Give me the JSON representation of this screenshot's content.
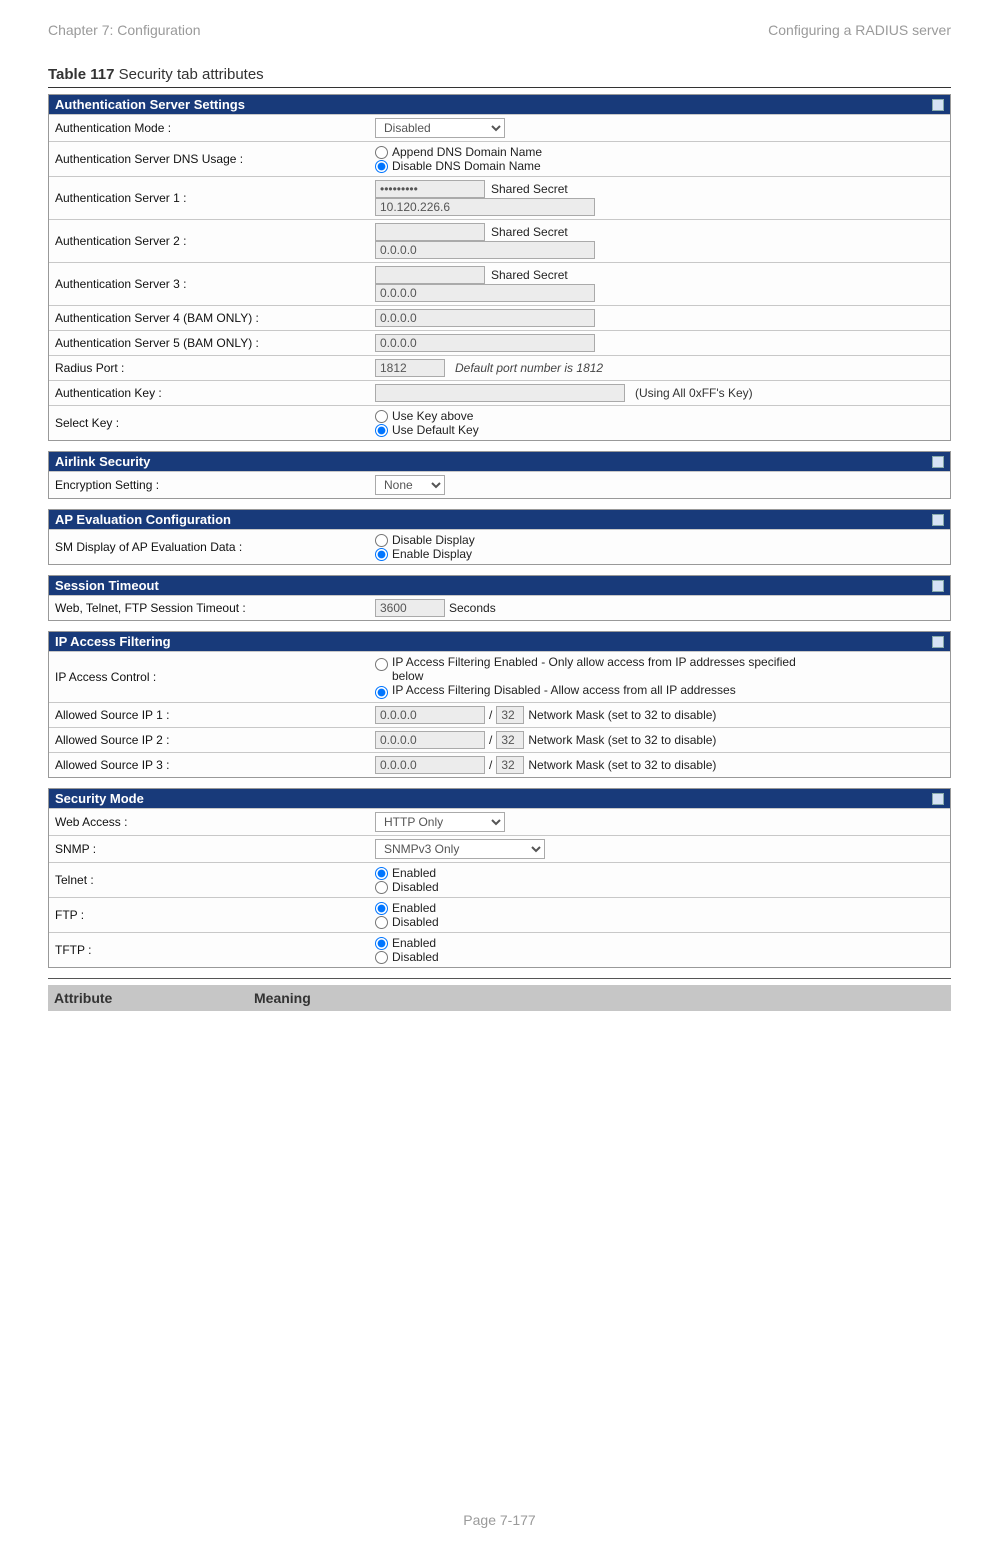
{
  "header": {
    "left": "Chapter 7:  Configuration",
    "right": "Configuring a RADIUS server"
  },
  "caption": {
    "bold": "Table 117",
    "rest": " Security tab attributes"
  },
  "auth": {
    "title": "Authentication Server Settings",
    "mode_label": "Authentication Mode :",
    "mode_value": "Disabled",
    "dns_label": "Authentication Server DNS Usage :",
    "dns_opt1": "Append DNS Domain Name",
    "dns_opt2": "Disable DNS Domain Name",
    "s1_label": "Authentication Server 1 :",
    "s1_secret": "•••••••••",
    "s1_secret_txt": "Shared Secret",
    "s1_ip": "10.120.226.6",
    "s2_label": "Authentication Server 2 :",
    "s2_secret_txt": "Shared Secret",
    "s2_ip": "0.0.0.0",
    "s3_label": "Authentication Server 3 :",
    "s3_secret_txt": "Shared Secret",
    "s3_ip": "0.0.0.0",
    "s4_label": "Authentication Server 4 (BAM ONLY) :",
    "s4_ip": "0.0.0.0",
    "s5_label": "Authentication Server 5 (BAM ONLY) :",
    "s5_ip": "0.0.0.0",
    "port_label": "Radius Port :",
    "port_value": "1812",
    "port_note": "Default port number is 1812",
    "key_label": "Authentication Key :",
    "key_note": "(Using All 0xFF's Key)",
    "selkey_label": "Select Key :",
    "selkey_opt1": "Use Key above",
    "selkey_opt2": "Use Default Key"
  },
  "airlink": {
    "title": "Airlink Security",
    "enc_label": "Encryption Setting :",
    "enc_value": "None"
  },
  "apeval": {
    "title": "AP Evaluation Configuration",
    "label": "SM Display of AP Evaluation Data :",
    "opt1": "Disable Display",
    "opt2": "Enable Display"
  },
  "session": {
    "title": "Session Timeout",
    "label": "Web, Telnet, FTP Session Timeout :",
    "value": "3600",
    "unit": "Seconds"
  },
  "ipfilter": {
    "title": "IP Access Filtering",
    "ctrl_label": "IP Access Control :",
    "opt1": "IP Access Filtering Enabled - Only allow access from IP addresses specified below",
    "opt2": "IP Access Filtering Disabled - Allow access from all IP addresses",
    "a1_label": "Allowed Source IP 1 :",
    "a2_label": "Allowed Source IP 2 :",
    "a3_label": "Allowed Source IP 3 :",
    "ip": "0.0.0.0",
    "mask": "32",
    "mask_note": "Network Mask (set to 32 to disable)"
  },
  "secmode": {
    "title": "Security Mode",
    "web_label": "Web Access :",
    "web_value": "HTTP Only",
    "snmp_label": "SNMP :",
    "snmp_value": "SNMPv3 Only",
    "telnet_label": "Telnet :",
    "ftp_label": "FTP :",
    "tftp_label": "TFTP :",
    "enabled": "Enabled",
    "disabled": "Disabled"
  },
  "attrbar": {
    "col1": "Attribute",
    "col2": "Meaning"
  },
  "footer": "Page 7-177"
}
